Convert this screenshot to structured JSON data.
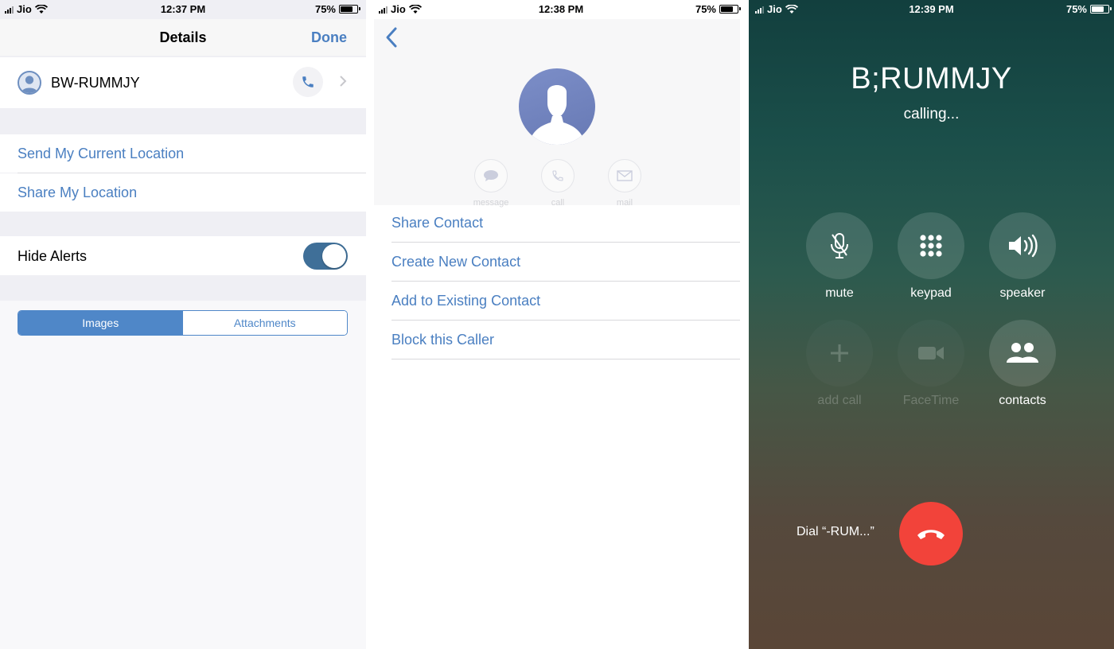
{
  "panel1": {
    "status": {
      "carrier": "Jio",
      "time": "12:37 PM",
      "battery": "75%"
    },
    "nav": {
      "title": "Details",
      "done_label": "Done"
    },
    "contact_name": "BW-RUMMJY",
    "location": {
      "send_current": "Send My Current Location",
      "share": "Share My Location"
    },
    "alerts": {
      "label": "Hide Alerts",
      "enabled": true
    },
    "segments": {
      "images": "Images",
      "attachments": "Attachments",
      "selected": "Images"
    }
  },
  "panel2": {
    "status": {
      "carrier": "Jio",
      "time": "12:38 PM",
      "battery": "75%"
    },
    "actions": {
      "message": "message",
      "call": "call",
      "mail": "mail"
    },
    "menu": [
      "Share Contact",
      "Create New Contact",
      "Add to Existing Contact",
      "Block this Caller"
    ]
  },
  "panel3": {
    "status": {
      "carrier": "Jio",
      "time": "12:39 PM",
      "battery": "75%"
    },
    "caller": "B;RUMMJY",
    "state": "calling...",
    "controls": {
      "mute": "mute",
      "keypad": "keypad",
      "speaker": "speaker",
      "add_call": "add call",
      "facetime": "FaceTime",
      "contacts": "contacts"
    },
    "dial_label": "Dial “-RUM...”"
  },
  "colors": {
    "ios_blue": "#4a7fc1",
    "toggle_on": "#3f6f98",
    "end_call_red": "#f2433a"
  }
}
